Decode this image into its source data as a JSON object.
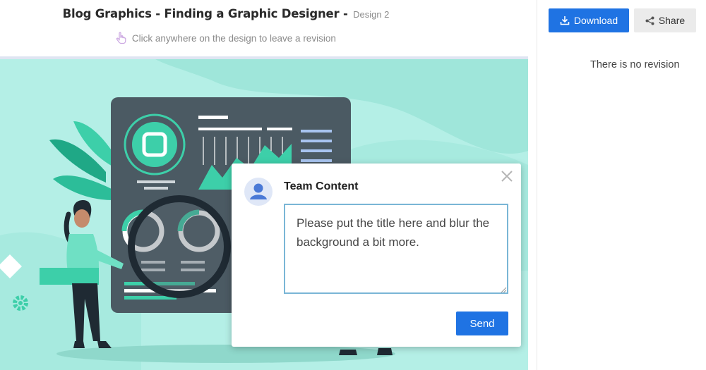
{
  "header": {
    "title": "Blog Graphics - Finding a Graphic Designer -",
    "subtitle": "Design 2",
    "hint": "Click anywhere on the design to leave a revision",
    "hint_icon": "pointer-hand-icon"
  },
  "right_panel": {
    "download_label": "Download",
    "download_icon": "download-icon",
    "share_label": "Share",
    "share_icon": "share-icon",
    "empty_message": "There is no revision"
  },
  "comment_popup": {
    "author": "Team Content",
    "text": "Please put the title here and blur the background a bit more.",
    "send_label": "Send",
    "close_icon": "close-icon",
    "avatar_icon": "user-avatar-icon"
  },
  "colors": {
    "accent": "#1f73e3",
    "canvas_bg": "#b4efe6",
    "teal": "#3dcfa9",
    "dashboard": "#4b5a63",
    "annotation_arrow": "#e53030"
  }
}
